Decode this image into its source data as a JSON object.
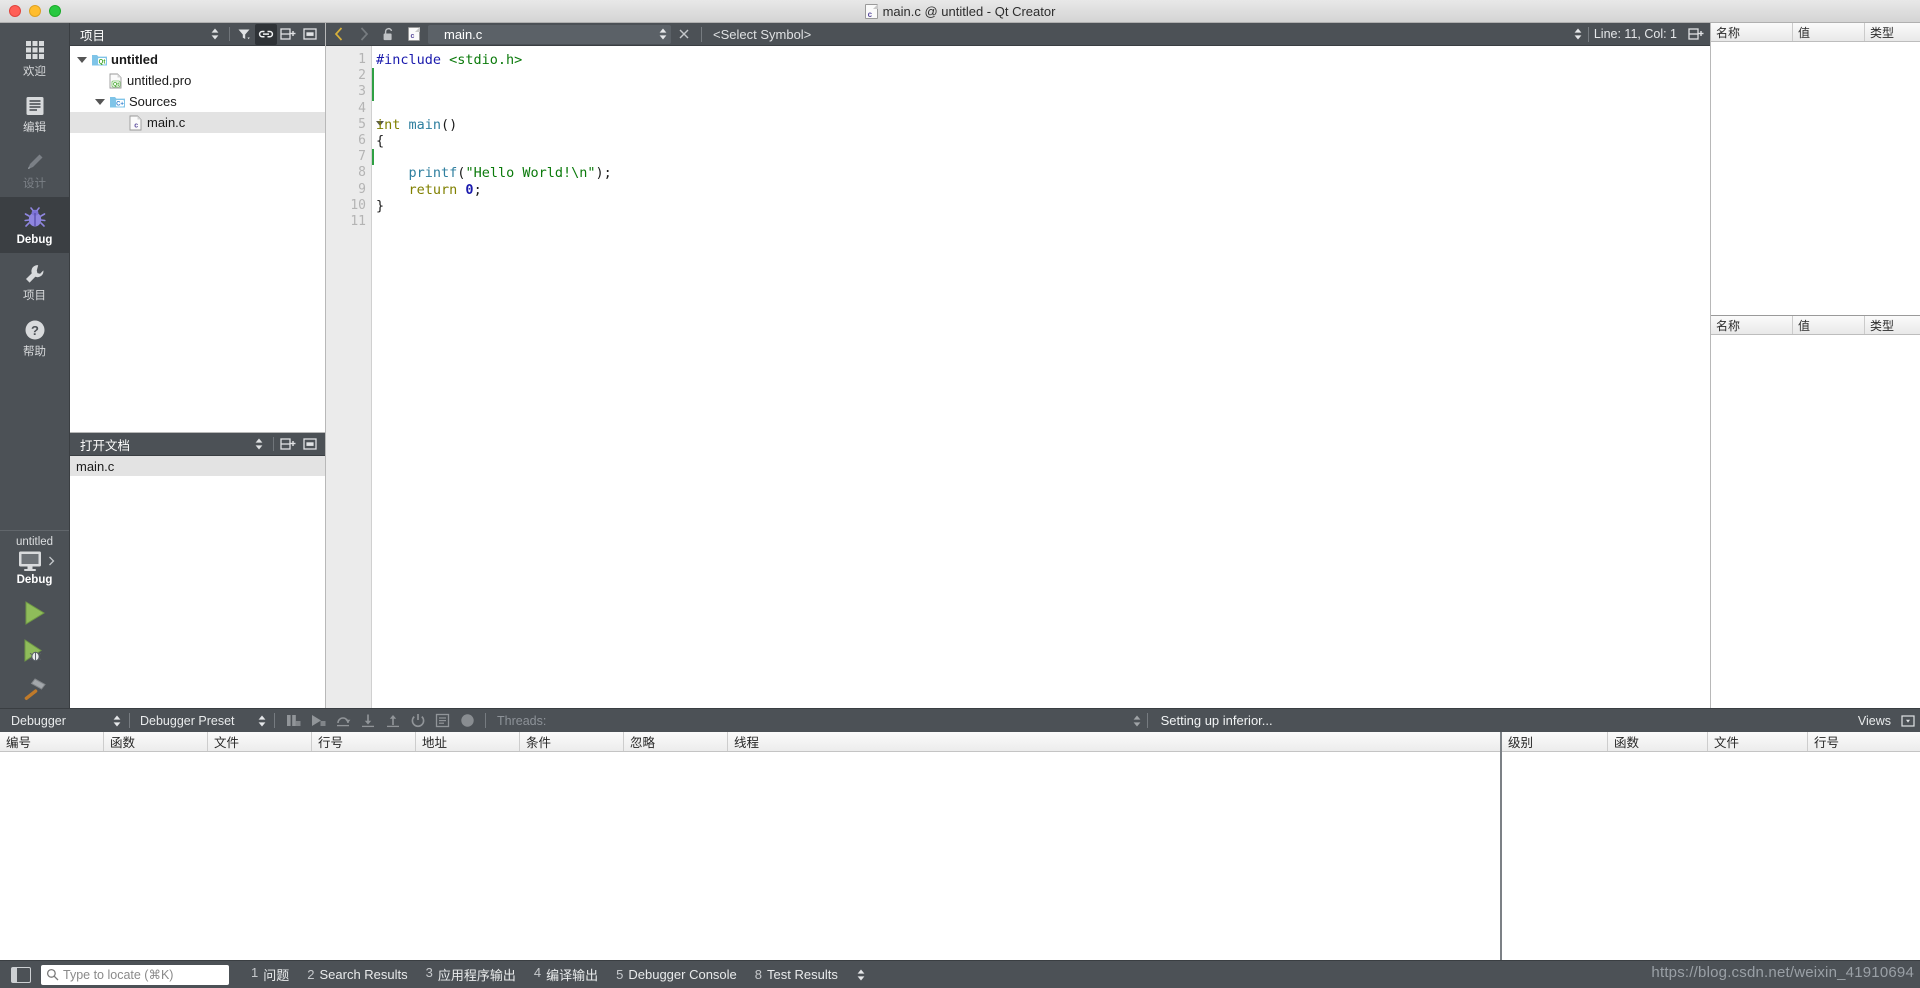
{
  "window": {
    "title": "main.c @ untitled - Qt Creator",
    "file_icon": "c-file-icon",
    "traffic_lights": [
      "close",
      "minimize",
      "zoom"
    ]
  },
  "modebar": {
    "items": [
      {
        "label": "欢迎",
        "icon": "grid-icon",
        "state": "normal"
      },
      {
        "label": "编辑",
        "icon": "document-lines-icon",
        "state": "normal"
      },
      {
        "label": "设计",
        "icon": "pencil-icon",
        "state": "disabled"
      },
      {
        "label": "Debug",
        "icon": "bug-icon",
        "state": "active"
      },
      {
        "label": "项目",
        "icon": "wrench-icon",
        "state": "normal"
      },
      {
        "label": "帮助",
        "icon": "question-circle-icon",
        "state": "normal"
      }
    ],
    "kit": {
      "project_name": "untitled",
      "build_config": "Debug",
      "icon": "desktop-monitor-icon",
      "arrow": "chevron-right-icon"
    },
    "actions": [
      {
        "name": "run-button",
        "icon": "green-play-triangle-icon"
      },
      {
        "name": "debug-button",
        "icon": "play-with-bug-icon"
      },
      {
        "name": "build-button",
        "icon": "hammer-icon"
      }
    ]
  },
  "project_panel": {
    "title": "项目",
    "header_buttons": [
      {
        "name": "view-selector",
        "icon": "up-down-arrows-icon",
        "active": false
      },
      {
        "name": "filter-button",
        "icon": "funnel-icon",
        "active": false
      },
      {
        "name": "sync-with-editor-button",
        "icon": "link-chain-icon",
        "active": true
      },
      {
        "name": "split-button",
        "icon": "split-plus-icon",
        "active": false
      },
      {
        "name": "close-panel-button",
        "icon": "close-panel-icon",
        "active": false
      }
    ],
    "tree": [
      {
        "label": "untitled",
        "indent": 0,
        "expander": "down",
        "icon": "qt-project-folder-icon",
        "bold": true,
        "selected": false
      },
      {
        "label": "untitled.pro",
        "indent": 1,
        "expander": "none",
        "icon": "qt-pro-file-icon",
        "bold": false,
        "selected": false
      },
      {
        "label": "Sources",
        "indent": 1,
        "expander": "down",
        "icon": "sources-folder-icon",
        "bold": false,
        "selected": false
      },
      {
        "label": "main.c",
        "indent": 2,
        "expander": "none",
        "icon": "c-file-icon",
        "bold": false,
        "selected": true
      }
    ]
  },
  "open_documents": {
    "title": "打开文档",
    "header_buttons": [
      {
        "name": "view-selector",
        "icon": "up-down-arrows-icon"
      },
      {
        "name": "split-button",
        "icon": "split-plus-icon"
      },
      {
        "name": "close-panel-button",
        "icon": "close-panel-icon"
      }
    ],
    "items": [
      {
        "label": "main.c",
        "selected": true
      }
    ]
  },
  "editor_toolbar": {
    "back_button": "chevron-left-icon",
    "forward_button": "chevron-right-icon",
    "lock_button": "unlocked-padlock-icon",
    "file_type_icon": "c-file-icon",
    "file_name": "main.c",
    "dropdown_icon": "up-down-arrows-icon",
    "close_button": "close-x-icon",
    "symbol_selector": "<Select Symbol>",
    "cursor_position": "Line: 11, Col: 1",
    "split_button": "split-plus-icon"
  },
  "editor": {
    "line_numbers": [
      "1",
      "2",
      "3",
      "4",
      "5",
      "6",
      "7",
      "8",
      "9",
      "10",
      "11"
    ],
    "fold_marker_line": 5,
    "modified_lines": [
      2,
      3,
      7
    ],
    "code_lines": [
      {
        "n": 1,
        "tokens": [
          {
            "t": "#include ",
            "c": "k-pre"
          },
          {
            "t": "<stdio.h>",
            "c": "k-str"
          }
        ]
      },
      {
        "n": 2,
        "tokens": []
      },
      {
        "n": 3,
        "tokens": []
      },
      {
        "n": 4,
        "tokens": []
      },
      {
        "n": 5,
        "tokens": [
          {
            "t": "int ",
            "c": "k-type"
          },
          {
            "t": "main",
            "c": "k-fn"
          },
          {
            "t": "()",
            "c": "k-plain"
          }
        ]
      },
      {
        "n": 6,
        "tokens": [
          {
            "t": "{",
            "c": "k-plain"
          }
        ]
      },
      {
        "n": 7,
        "tokens": []
      },
      {
        "n": 8,
        "tokens": [
          {
            "t": "    ",
            "c": "k-plain"
          },
          {
            "t": "printf",
            "c": "k-fn"
          },
          {
            "t": "(",
            "c": "k-plain"
          },
          {
            "t": "\"Hello World!\\n\"",
            "c": "k-str"
          },
          {
            "t": ");",
            "c": "k-plain"
          }
        ]
      },
      {
        "n": 9,
        "tokens": [
          {
            "t": "    ",
            "c": "k-plain"
          },
          {
            "t": "return ",
            "c": "k-type"
          },
          {
            "t": "0",
            "c": "k-num"
          },
          {
            "t": ";",
            "c": "k-plain"
          }
        ]
      },
      {
        "n": 10,
        "tokens": [
          {
            "t": "}",
            "c": "k-plain"
          }
        ]
      },
      {
        "n": 11,
        "tokens": []
      }
    ],
    "plain_text": "#include <stdio.h>\n\n\n\nint main()\n{\n\n    printf(\"Hello World!\\n\");\n    return 0;\n}\n"
  },
  "watch_panels": [
    {
      "name": "locals-and-expressions",
      "columns": [
        "名称",
        "值",
        "类型"
      ],
      "rows": []
    },
    {
      "name": "watchers",
      "columns": [
        "名称",
        "值",
        "类型"
      ],
      "rows": []
    }
  ],
  "debugger": {
    "engine_combo": "Debugger",
    "preset_combo": "Debugger Preset",
    "toolbar_icons": [
      {
        "name": "interrupt-button",
        "icon": "pause-icon"
      },
      {
        "name": "continue-button",
        "icon": "continue-icon"
      },
      {
        "name": "step-over-button",
        "icon": "step-over-icon"
      },
      {
        "name": "step-into-button",
        "icon": "step-into-icon"
      },
      {
        "name": "step-out-button",
        "icon": "step-out-icon"
      },
      {
        "name": "restart-button",
        "icon": "restart-power-icon"
      },
      {
        "name": "instruction-mode-button",
        "icon": "instruction-lines-icon"
      },
      {
        "name": "record-button",
        "icon": "record-circle-icon"
      }
    ],
    "threads_label": "Threads:",
    "status": "Setting up inferior...",
    "views_button": "Views",
    "views_icon": "dropdown-box-icon",
    "breakpoints": {
      "columns": [
        "编号",
        "函数",
        "文件",
        "行号",
        "地址",
        "条件",
        "忽略",
        "线程"
      ],
      "rows": []
    },
    "stack": {
      "columns": [
        "级别",
        "函数",
        "文件",
        "行号"
      ],
      "rows": []
    }
  },
  "statusbar": {
    "sidebar_toggle_icon": "sidebar-toggle-icon",
    "locator_icon": "search-icon",
    "locator_placeholder": "Type to locate (⌘K)",
    "output_panes": [
      {
        "num": "1",
        "label": "问题"
      },
      {
        "num": "2",
        "label": "Search Results"
      },
      {
        "num": "3",
        "label": "应用程序输出"
      },
      {
        "num": "4",
        "label": "编译输出"
      },
      {
        "num": "5",
        "label": "Debugger Console"
      },
      {
        "num": "8",
        "label": "Test Results"
      }
    ],
    "more_icon": "up-down-arrows-icon",
    "watermark": "https://blog.csdn.net/weixin_41910694"
  },
  "colors": {
    "chrome_dark": "#4c5156",
    "mode_active": "#3b3f43",
    "accent_green": "#8fbc5a",
    "string_green": "#0b7a0b",
    "keyword_blue": "#1a1aad",
    "type_olive": "#808000",
    "function_teal": "#2f7f9f",
    "selection_gray": "#e3e3e3"
  }
}
